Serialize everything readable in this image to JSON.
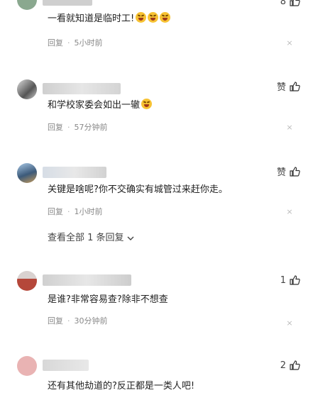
{
  "comments": [
    {
      "text": "一看就知道是临时工!",
      "meta_reply": "回复",
      "meta_time": "5小时前",
      "emoji_count": 3,
      "avatar_color": "#8aa88f",
      "like_label": "8",
      "show_top_like": true
    },
    {
      "text": "和学校家委会如出一辙",
      "meta_reply": "回复",
      "meta_time": "57分钟前",
      "like_label": "赞",
      "avatar_color": "#777777"
    },
    {
      "text": "关键是啥呢?你不交确实有城管过来赶你走。",
      "meta_reply": "回复",
      "meta_time": "1小时前",
      "like_label": "赞",
      "avatar_color": "#5c7ea6"
    },
    {
      "text": "是谁?非常容易查?除非不想查",
      "meta_reply": "回复",
      "meta_time": "30分钟前",
      "like_label": "1",
      "avatar_color": "#b5473a"
    },
    {
      "text": "还有其他劫道的?反正都是一类人吧!",
      "like_label": "2",
      "avatar_color": "#e9b3b3"
    }
  ],
  "view_all_replies": "查看全部 1 条回复"
}
